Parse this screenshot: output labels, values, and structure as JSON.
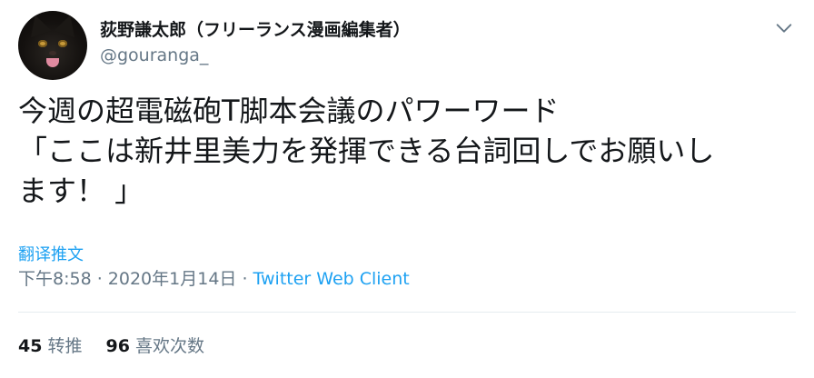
{
  "author": {
    "display_name": "荻野謙太郎（フリーランス漫画編集者）",
    "handle": "@gouranga_"
  },
  "tweet": {
    "lines": [
      "今週の超電磁砲T脚本会議のパワーワード",
      "「ここは新井里美力を発揮できる台詞回しでお願いし",
      "ます！ 」"
    ]
  },
  "translate_label": "翻译推文",
  "meta": {
    "time": "下午8:58",
    "separator": " · ",
    "date": "2020年1月14日",
    "client": "Twitter Web Client"
  },
  "stats": {
    "retweets_count": "45",
    "retweets_label": "转推",
    "likes_count": "96",
    "likes_label": "喜欢次数"
  },
  "colors": {
    "link": "#1da1f2",
    "secondary_text": "#657786",
    "primary_text": "#14171a"
  },
  "icons": {
    "menu": "chevron-down-icon"
  }
}
